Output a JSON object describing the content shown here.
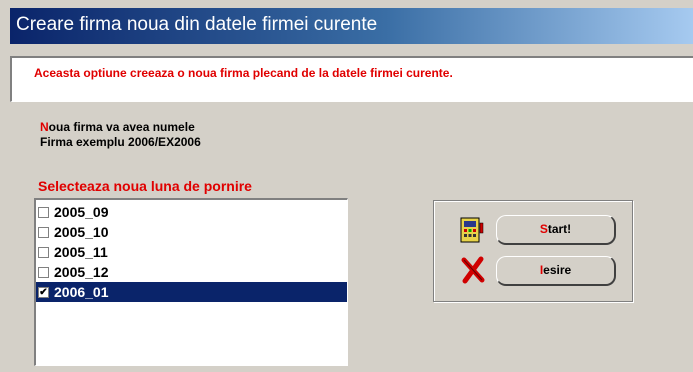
{
  "window": {
    "title": "Creare firma noua din datele firmei curente"
  },
  "info": {
    "message": "Aceasta optiune creeaza o noua firma plecand de la datele firmei curente."
  },
  "firm": {
    "label_first_letter": "N",
    "label_rest": "oua firma va avea numele",
    "name": "Firma exemplu 2006/EX2006"
  },
  "month_select": {
    "label": "Selecteaza noua luna de pornire",
    "items": [
      {
        "label": "2005_09",
        "checked": false
      },
      {
        "label": "2005_10",
        "checked": false
      },
      {
        "label": "2005_11",
        "checked": false
      },
      {
        "label": "2005_12",
        "checked": false
      },
      {
        "label": "2006_01",
        "checked": true
      }
    ]
  },
  "buttons": {
    "start": {
      "hotkey": "S",
      "rest": "tart!",
      "icon": "calculator-icon"
    },
    "exit": {
      "hotkey": "I",
      "rest": "esire",
      "icon": "red-x-icon"
    }
  },
  "colors": {
    "accent_red": "#e00000",
    "selection_blue": "#0a246a",
    "window_bg": "#d4d0c8"
  }
}
